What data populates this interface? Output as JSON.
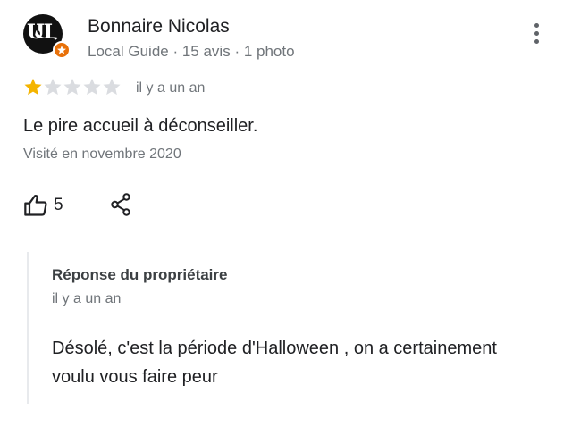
{
  "review": {
    "author": "Bonnaire Nicolas",
    "author_role": "Local Guide",
    "review_count": "15 avis",
    "photo_count": "1 photo",
    "rating": 1,
    "rating_max": 5,
    "time_ago": "il y a un an",
    "text": "Le pire accueil à déconseiller.",
    "visited": "Visité en novembre 2020",
    "likes": "5",
    "colors": {
      "star_filled": "#f4b400",
      "star_empty": "#dadce0",
      "badge": "#e8710a",
      "secondary_text": "#70757a"
    }
  },
  "owner_reply": {
    "title": "Réponse du propriétaire",
    "time_ago": "il y a un an",
    "text": "Désolé, c'est la période d'Halloween , on a certainement voulu vous faire peur"
  },
  "icons": {
    "more": "more-vert-icon",
    "like": "thumb-up-icon",
    "share": "share-icon",
    "guide": "local-guide-badge-icon"
  }
}
